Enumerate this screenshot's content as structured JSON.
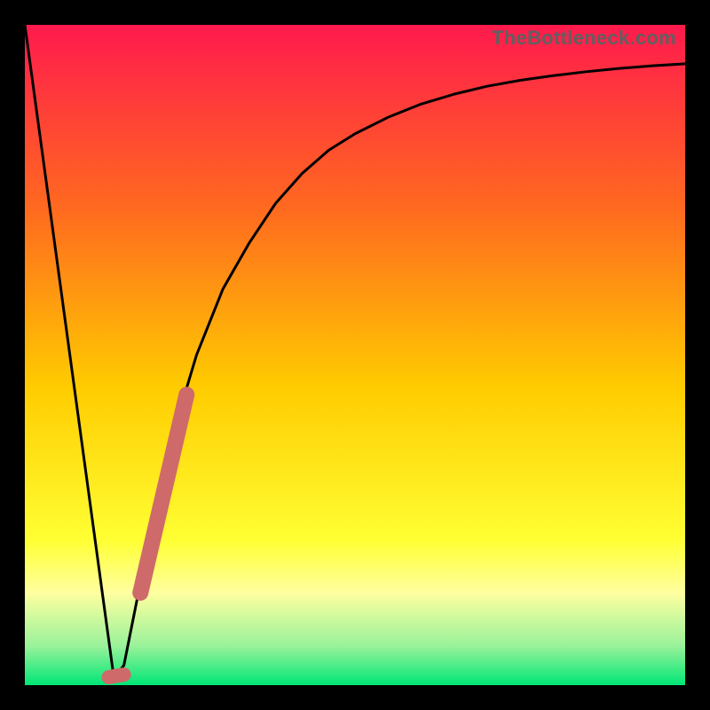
{
  "watermark": "TheBottleneck.com",
  "colors": {
    "frame": "#000000",
    "grad_top": "#ff1a4d",
    "grad_mid_upper": "#ff6a1f",
    "grad_mid": "#ffcc00",
    "grad_mid_lower": "#ffff33",
    "grad_band": "#ffffa0",
    "grad_low": "#9af29a",
    "grad_bottom": "#00e676",
    "curve": "#000000",
    "marker": "#cf6a6a"
  },
  "chart_data": {
    "type": "line",
    "title": "",
    "xlabel": "",
    "ylabel": "",
    "xlim": [
      0,
      100
    ],
    "ylim": [
      0,
      100
    ],
    "series": [
      {
        "name": "bottleneck-curve",
        "x": [
          0,
          3,
          6,
          9,
          12,
          13.5,
          15,
          17,
          20,
          23,
          26,
          30,
          34,
          38,
          42,
          46,
          50,
          55,
          60,
          65,
          70,
          75,
          80,
          85,
          90,
          95,
          100
        ],
        "values": [
          100,
          78,
          56,
          34,
          12,
          1,
          3,
          13,
          27,
          40,
          50,
          60,
          67,
          73,
          77.5,
          81,
          83.5,
          86,
          88,
          89.5,
          90.7,
          91.6,
          92.3,
          92.9,
          93.4,
          93.8,
          94.1
        ]
      }
    ],
    "markers": [
      {
        "name": "min-dot",
        "shape": "capsule",
        "x0": 12.7,
        "y0": 1.2,
        "x1": 15.0,
        "y1": 1.6
      },
      {
        "name": "right-slope-bar",
        "shape": "capsule",
        "x0": 17.5,
        "y0": 14,
        "x1": 24.5,
        "y1": 44
      }
    ]
  }
}
